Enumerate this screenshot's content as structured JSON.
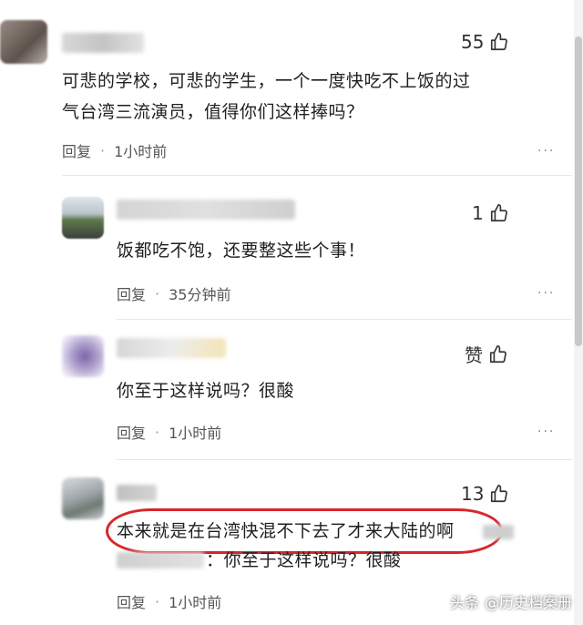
{
  "comments": [
    {
      "likes": "55",
      "text_line1": "可悲的学校，可悲的学生，一个一度快吃不上饭的过",
      "text_line2": "气台湾三流演员，值得你们这样捧吗？",
      "reply_label": "回复",
      "time": "1小时前"
    },
    {
      "likes": "1",
      "text": "饭都吃不饱，还要整这些个事！",
      "reply_label": "回复",
      "time": "35分钟前"
    },
    {
      "likes": "赞",
      "text": "你至于这样说吗？很酸",
      "reply_label": "回复",
      "time": "1小时前"
    },
    {
      "likes": "13",
      "text": "本来就是在台湾快混不下去了才来大陆的啊",
      "quote_text": "：你至于这样说吗？很酸",
      "reply_label": "回复",
      "time": "1小时前"
    }
  ],
  "more_glyph": "···",
  "watermark": {
    "prefix": "头条",
    "author": "@历史档案册"
  },
  "colors": {
    "highlight_ring": "#d9262b",
    "text": "#1f1f1f",
    "meta": "#555555"
  },
  "icons": [
    "thumbs-up-icon",
    "more-icon"
  ]
}
